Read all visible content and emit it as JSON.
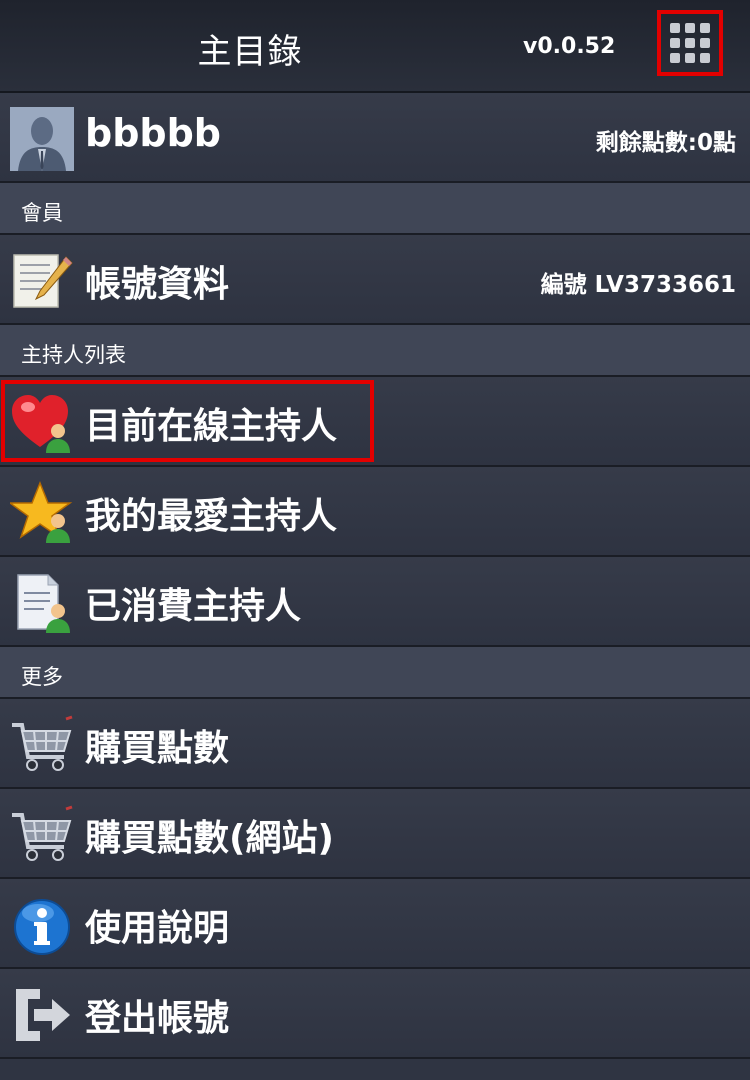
{
  "header": {
    "title": "主目錄",
    "version": "v0.0.52",
    "menu_icon": "grid-menu-icon"
  },
  "user": {
    "name": "bbbbb",
    "points": "剩餘點數:0點"
  },
  "sections": {
    "member": "會員",
    "hosts": "主持人列表",
    "more": "更多"
  },
  "items": {
    "account": {
      "label": "帳號資料",
      "right": "編號 LV3733661",
      "icon": "notepad-icon"
    },
    "online_hosts": {
      "label": "目前在線主持人",
      "icon": "heart-person-icon"
    },
    "favorite_hosts": {
      "label": "我的最愛主持人",
      "icon": "star-person-icon"
    },
    "consumed_hosts": {
      "label": "已消費主持人",
      "icon": "document-person-icon"
    },
    "buy_points": {
      "label": "購買點數",
      "icon": "cart-icon"
    },
    "buy_points_web": {
      "label": "購買點數(網站)",
      "icon": "cart-icon"
    },
    "help": {
      "label": "使用說明",
      "icon": "info-icon"
    },
    "logout": {
      "label": "登出帳號",
      "icon": "logout-icon"
    }
  },
  "colors": {
    "background": "#2f3442",
    "section": "#404656",
    "highlight": "#e30000"
  }
}
